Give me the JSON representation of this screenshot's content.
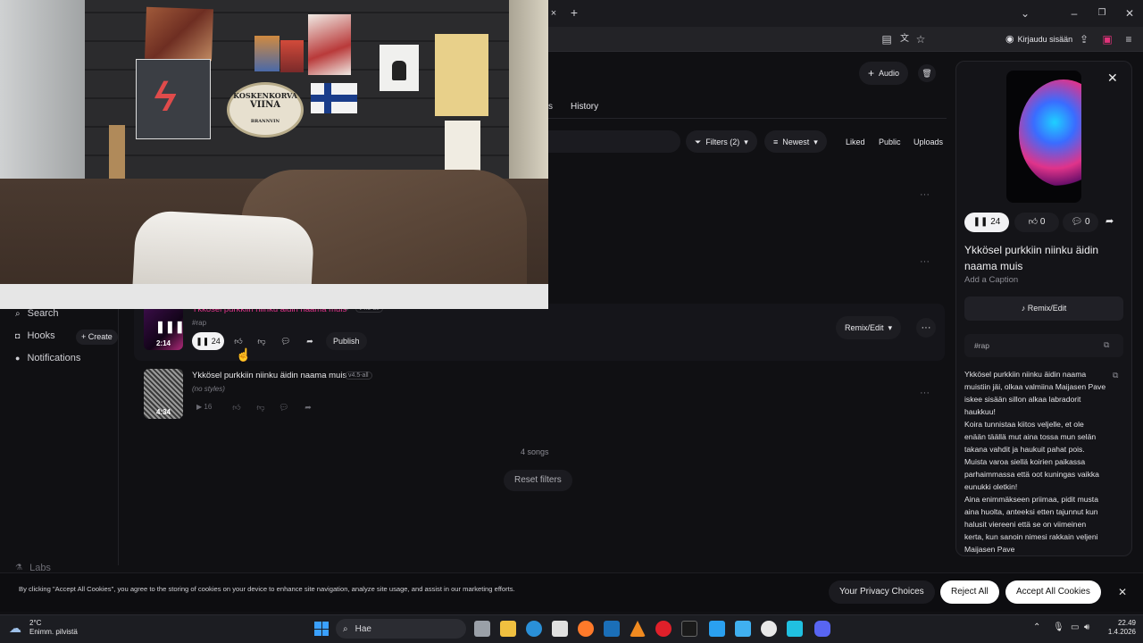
{
  "browser": {
    "signin_label": "Kirjaudu sisään",
    "tab_close": "×",
    "tab_new": "+"
  },
  "toolbar": {
    "audio_label": "Audio",
    "history_tab": "History",
    "tab_fragment": "s",
    "filters_label": "Filters (2)",
    "sort_label": "Newest",
    "liked_label": "Liked",
    "public_label": "Public",
    "uploads_label": "Uploads"
  },
  "sidebar": {
    "items": [
      {
        "label": "Search",
        "icon": "search-icon"
      },
      {
        "label": "Hooks",
        "icon": "hooks-icon"
      },
      {
        "label": "Notifications",
        "icon": "bell-icon"
      },
      {
        "label": "Labs",
        "icon": "labs-icon"
      }
    ],
    "create_label": "+ Create"
  },
  "songs": [
    {
      "title": "Ykkösel purkkiin niinku äidin naama muis",
      "version": "v4.5-all",
      "tag": "#rap",
      "duration": "2:14",
      "plays": "24",
      "publish_label": "Publish",
      "remix_label": "Remix/Edit"
    },
    {
      "title": "Ykkösel purkkiin niinku äidin naama muis",
      "version": "v4.5-all",
      "tag": "(no styles)",
      "duration": "4:34",
      "plays": "16"
    }
  ],
  "list_footer": {
    "count": "4 songs",
    "reset_label": "Reset filters"
  },
  "panel": {
    "plays": "24",
    "likes": "0",
    "comments": "0",
    "title": "Ykkösel purkkiin niinku äidin naama muis",
    "caption_placeholder": "Add a Caption",
    "remix_label": "Remix/Edit",
    "tag": "#rap",
    "lyrics": [
      "Ykkösel purkkiin niinku äidin naama",
      "muistiin jäi, olkaa valmiina Maijasen Pave",
      "iskee sisään sillon alkaa labradorit",
      "haukkuu!",
      "Koira tunnistaa kiitos veljelle, et ole",
      "enään täällä mut aina tossa mun selän",
      "takana vahdit ja haukuit pahat pois.",
      "Muista varoa siellä koirien paikassa",
      "parhaimmassa että oot kuningas vaikka",
      "eunukki oletkin!",
      "Aina enimmäkseen priimaa, pidit musta",
      "aina huolta, anteeksi etten tajunnut kun",
      "halusit viereeni että se on viimeinen",
      "kerta, kun sanoin nimesi rakkain veljeni",
      "Maijasen Pave"
    ]
  },
  "cookie": {
    "text": "By clicking \"Accept All Cookies\", you agree to the storing of cookies on your device to enhance site navigation, analyze site usage, and assist in our marketing efforts.",
    "privacy_label": "Your Privacy Choices",
    "reject_label": "Reject All",
    "accept_label": "Accept All Cookies"
  },
  "webcam": {
    "poster_text_1": "KOSKENKORVA",
    "poster_text_2": "VIINA",
    "poster_text_3": "BRANNVIN"
  },
  "taskbar": {
    "temp": "2°C",
    "weather": "Enimm. pilvistä",
    "search_placeholder": "Hae",
    "time": "22.49",
    "date": "1.4.2026"
  },
  "colors": {
    "accent_pink": "#e0338a",
    "accept_bg": "#ffffff"
  }
}
